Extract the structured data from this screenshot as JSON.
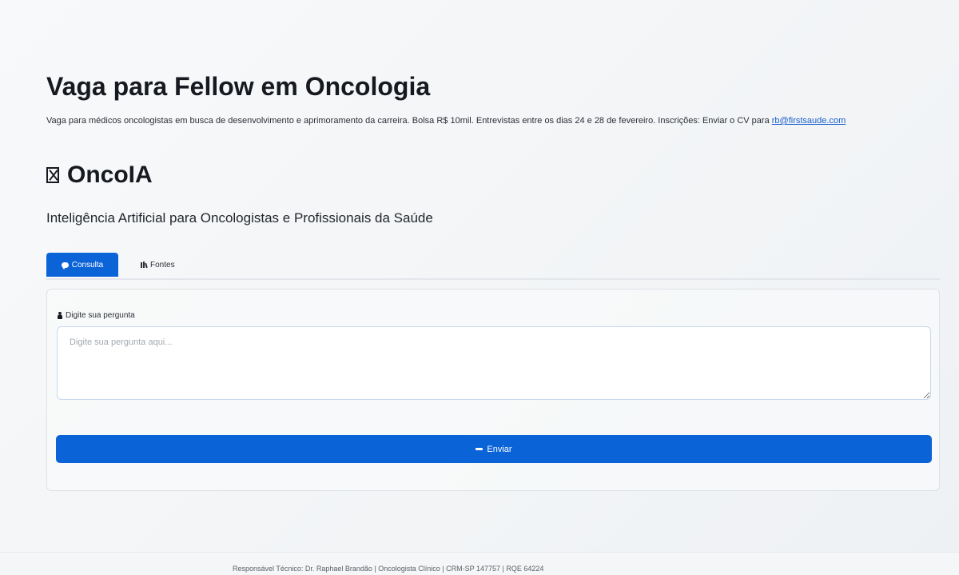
{
  "announcement": {
    "title": "Vaga para Fellow em Oncologia",
    "description": "Vaga para médicos oncologistas em busca de desenvolvimento e aprimoramento da carreira. Bolsa R$ 10mil. Entrevistas entre os dias 24 e 28 de fevereiro. Inscrições: Enviar o CV para ",
    "email_link": "rb@firstsaude.com"
  },
  "app": {
    "logo_icon": "crossed-box-icon",
    "title": "OncoIA",
    "subtitle": "Inteligência Artificial para Oncologistas e Profissionais da Saúde"
  },
  "tabs": [
    {
      "label": "Consulta",
      "icon": "speech-bubble-icon",
      "active": true
    },
    {
      "label": "Fontes",
      "icon": "books-icon",
      "active": false
    }
  ],
  "form": {
    "label": "Digite sua pergunta",
    "label_icon": "person-icon",
    "input_value": "",
    "input_placeholder": "Digite sua pergunta aqui...",
    "submit_label": "Enviar",
    "submit_icon": "dash-icon"
  },
  "footer": {
    "text": "Responsável Técnico: Dr. Raphael Brandão | Oncologista Clínico | CRM-SP 147757 | RQE 64224"
  },
  "colors": {
    "accent": "#0b63d8",
    "link": "#1a5fcc",
    "text": "#16191f"
  }
}
